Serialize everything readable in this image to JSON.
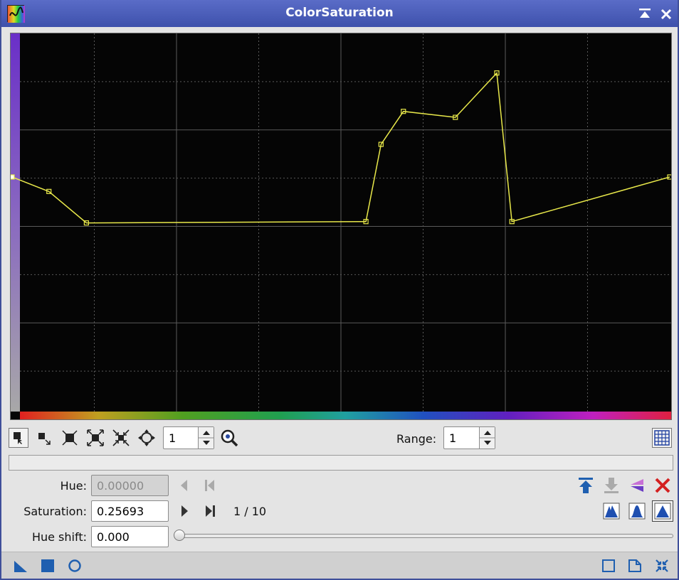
{
  "window": {
    "title": "ColorSaturation",
    "accent_color": "#3e51ac",
    "icons": [
      "app-icon",
      "shade-icon",
      "close-icon"
    ]
  },
  "graph": {
    "background": "#000000",
    "curve_color": "#e8e84a",
    "grid_color": "#5a5a5a",
    "icons": [
      "hue-gradient-bar",
      "saturation-gradient-bar"
    ]
  },
  "toolbar": {
    "icons": [
      "edit-point-mode-icon",
      "select-point-mode-icon",
      "delete-point-mode-icon",
      "zoom-in-icon",
      "zoom-out-icon",
      "pan-icon",
      "zoom-icon",
      "show-grid-icon"
    ],
    "zoom_value": "1",
    "range_label": "Range:",
    "range_value": "1"
  },
  "controls": {
    "hue_label": "Hue:",
    "hue_value": "0.00000",
    "saturation_label": "Saturation:",
    "saturation_value": "0.25693",
    "hue_shift_label": "Hue shift:",
    "hue_shift_value": "0.000",
    "point_counter": "1 / 10",
    "hue_shift_level": 0,
    "icons": [
      "previous-point-icon",
      "first-point-icon",
      "next-point-icon",
      "last-point-icon",
      "store-curve-icon",
      "restore-curve-icon",
      "reverse-curve-icon",
      "reset-curve-icon",
      "akima-interpolation-icon",
      "cubic-spline-icon",
      "linear-interpolation-icon"
    ]
  },
  "bottombar": {
    "icons": [
      "new-instance-icon",
      "apply-global-icon",
      "apply-icon",
      "preview-icon",
      "browse-documentation-icon",
      "reset-icon"
    ]
  },
  "chart_data": {
    "type": "line",
    "xlim": [
      0,
      1
    ],
    "ylim": [
      -1,
      1
    ],
    "grid": true,
    "points": [
      [
        0.0,
        0.256
      ],
      [
        0.056,
        0.181
      ],
      [
        0.113,
        0.018
      ],
      [
        0.538,
        0.025
      ],
      [
        0.561,
        0.425
      ],
      [
        0.595,
        0.596
      ],
      [
        0.674,
        0.565
      ],
      [
        0.737,
        0.795
      ],
      [
        0.76,
        0.025
      ],
      [
        1.0,
        0.256
      ]
    ]
  }
}
